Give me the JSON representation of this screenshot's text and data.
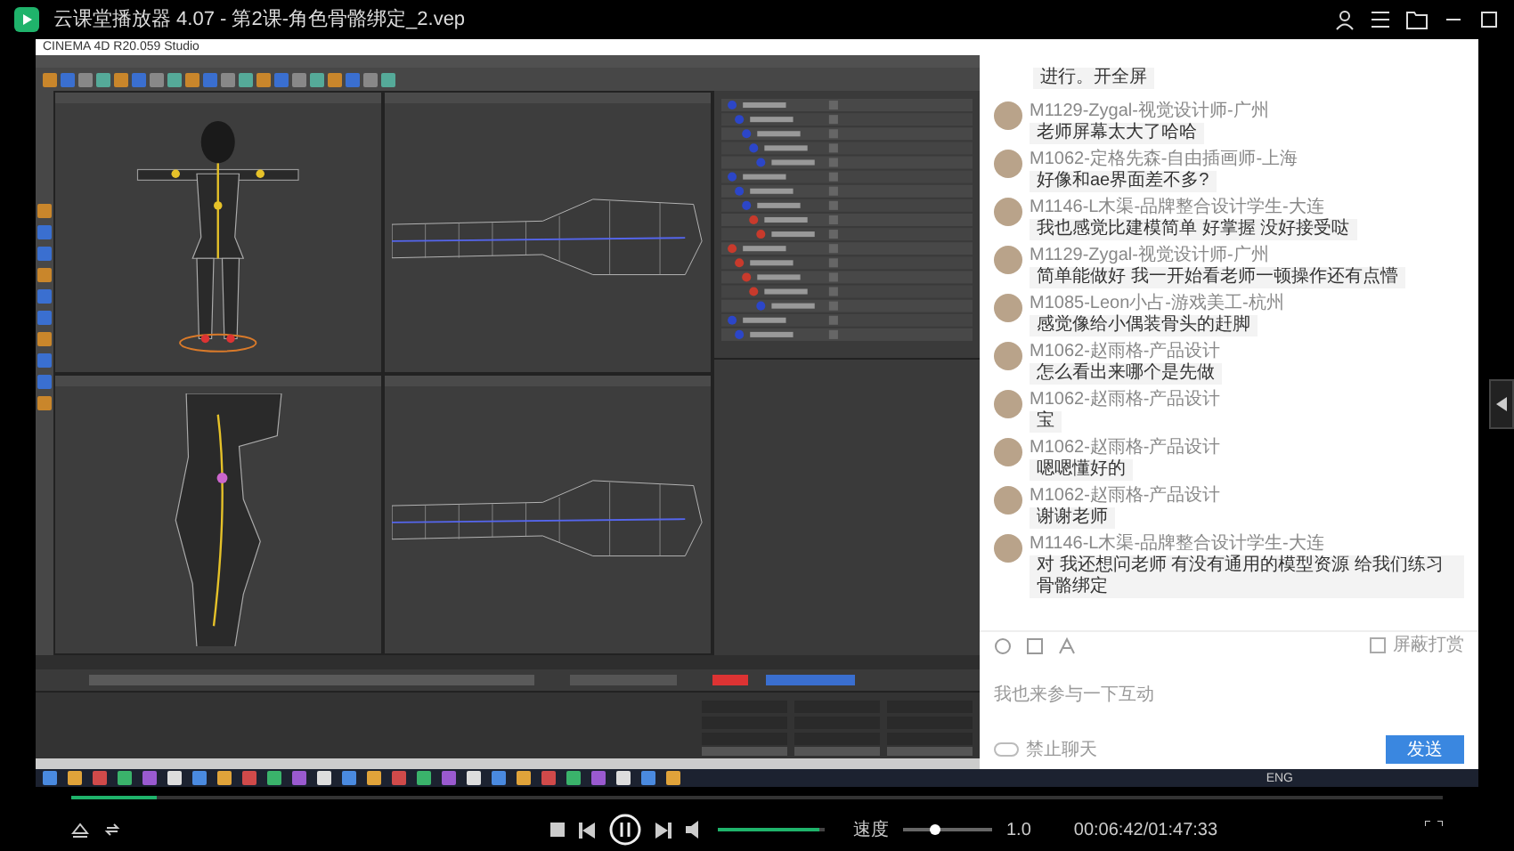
{
  "player": {
    "title": "云课堂播放器 4.07 - 第2课-角色骨骼绑定_2.vep",
    "progress": {
      "level": 0.062
    },
    "volume": {
      "level": 0.95
    },
    "speed_label": "速度",
    "speed": {
      "level": 0.35
    },
    "speed_value": "1.0",
    "time": "00:06:42/01:47:33"
  },
  "app": {
    "title": "CINEMA 4D R20.059 Studio"
  },
  "chat": {
    "messages": [
      {
        "kind": "text",
        "text": "进行。开全屏"
      },
      {
        "kind": "user",
        "author": "M1129-Zygal-视觉设计师-广州",
        "text": "老师屏幕太大了哈哈"
      },
      {
        "kind": "user",
        "author": "M1062-定格先森-自由插画师-上海",
        "text": "好像和ae界面差不多?"
      },
      {
        "kind": "user",
        "author": "M1146-L木渠-品牌整合设计学生-大连",
        "text": "我也感觉比建模简单 好掌握 没好接受哒"
      },
      {
        "kind": "user",
        "author": "M1129-Zygal-视觉设计师-广州",
        "text": "简单能做好 我一开始看老师一顿操作还有点懵"
      },
      {
        "kind": "user",
        "author": "M1085-Leon小占-游戏美工-杭州",
        "text": "感觉像给小偶装骨头的赶脚"
      },
      {
        "kind": "user",
        "author": "M1062-赵雨格-产品设计",
        "text": "怎么看出来哪个是先做"
      },
      {
        "kind": "user",
        "author": "M1062-赵雨格-产品设计",
        "text": "宝"
      },
      {
        "kind": "user",
        "author": "M1062-赵雨格-产品设计",
        "text": "嗯嗯懂好的"
      },
      {
        "kind": "user",
        "author": "M1062-赵雨格-产品设计",
        "text": "谢谢老师"
      },
      {
        "kind": "user",
        "author": "M1146-L木渠-品牌整合设计学生-大连",
        "text": "对 我还想问老师 有没有通用的模型资源 给我们练习骨骼绑定"
      }
    ],
    "block_gifts": {
      "label": "屏蔽打赏",
      "checked": false
    },
    "input": {
      "placeholder": "我也来参与一下互动"
    },
    "mute": {
      "label": "禁止聊天",
      "on": false
    },
    "send": "发送"
  },
  "taskbar": {
    "language": "ENG"
  }
}
